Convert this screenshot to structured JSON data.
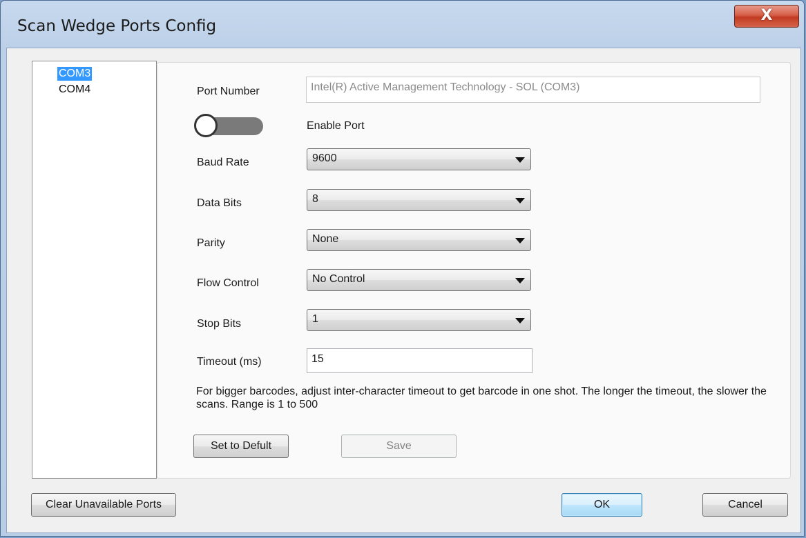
{
  "window": {
    "title": "Scan Wedge Ports Config",
    "close_label": "X"
  },
  "ports": {
    "items": [
      "COM3",
      "COM4"
    ],
    "selected": "COM3"
  },
  "form": {
    "port_number": {
      "label": "Port Number",
      "value": "Intel(R) Active Management Technology - SOL (COM3)"
    },
    "enable_port": {
      "label": "Enable Port",
      "state": "off"
    },
    "baud_rate": {
      "label": "Baud Rate",
      "value": "9600"
    },
    "data_bits": {
      "label": "Data Bits",
      "value": "8"
    },
    "parity": {
      "label": "Parity",
      "value": "None"
    },
    "flow_control": {
      "label": "Flow Control",
      "value": "No Control"
    },
    "stop_bits": {
      "label": "Stop Bits",
      "value": "1"
    },
    "timeout": {
      "label": "Timeout (ms)",
      "value": "15"
    },
    "hint": "For bigger barcodes, adjust inter-character timeout to get barcode in one shot. The longer the timeout, the slower the scans. Range is 1 to 500"
  },
  "buttons": {
    "set_default": "Set to Defult",
    "save": "Save",
    "clear_unavailable": "Clear Unavailable Ports",
    "ok": "OK",
    "cancel": "Cancel"
  },
  "colors": {
    "selection": "#3399ff",
    "close_button": "#c9452b",
    "toggle_track_off": "#7a7a7a"
  }
}
